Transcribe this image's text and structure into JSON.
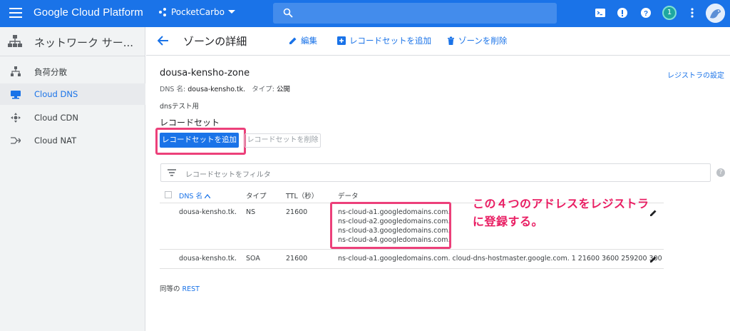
{
  "topbar": {
    "brand": "Google Cloud Platform",
    "project": "PocketCarbo",
    "notification_count": "1"
  },
  "sidebar": {
    "title": "ネットワーク サー...",
    "items": [
      {
        "label": "負荷分散",
        "icon": "load-balancing-icon"
      },
      {
        "label": "Cloud DNS",
        "icon": "dns-icon",
        "active": true
      },
      {
        "label": "Cloud CDN",
        "icon": "cdn-icon"
      },
      {
        "label": "Cloud NAT",
        "icon": "nat-icon"
      }
    ]
  },
  "header": {
    "title": "ゾーンの詳細",
    "edit": "編集",
    "add_recordset": "レコードセットを追加",
    "delete_zone": "ゾーンを削除"
  },
  "zone": {
    "name": "dousa-kensho-zone",
    "dns_label": "DNS 名:",
    "dns_value": "dousa-kensho.tk.",
    "type_label": "タイプ:",
    "type_value": "公開",
    "description": "dnsテスト用",
    "registrar_link": "レジストラの設定"
  },
  "recordsets": {
    "heading": "レコードセット",
    "add_button": "レコードセットを追加",
    "delete_button": "レコードセットを削除",
    "filter_placeholder": "レコードセットをフィルタ",
    "columns": [
      "DNS 名",
      "タイプ",
      "TTL（秒）",
      "データ"
    ],
    "rows": [
      {
        "dns": "dousa-kensho.tk.",
        "type": "NS",
        "ttl": "21600",
        "data": [
          "ns-cloud-a1.googledomains.com.",
          "ns-cloud-a2.googledomains.com.",
          "ns-cloud-a3.googledomains.com.",
          "ns-cloud-a4.googledomains.com."
        ]
      },
      {
        "dns": "dousa-kensho.tk.",
        "type": "SOA",
        "ttl": "21600",
        "data": [
          "ns-cloud-a1.googledomains.com. cloud-dns-hostmaster.google.com. 1 21600 3600 259200 300"
        ]
      }
    ]
  },
  "annotation": {
    "line1": "この４つのアドレスをレジストラ",
    "line2": "に登録する。"
  },
  "footer": {
    "prefix": "同等の",
    "link": "REST"
  },
  "colors": {
    "accent": "#1a73e8",
    "highlight": "#ec407a"
  }
}
